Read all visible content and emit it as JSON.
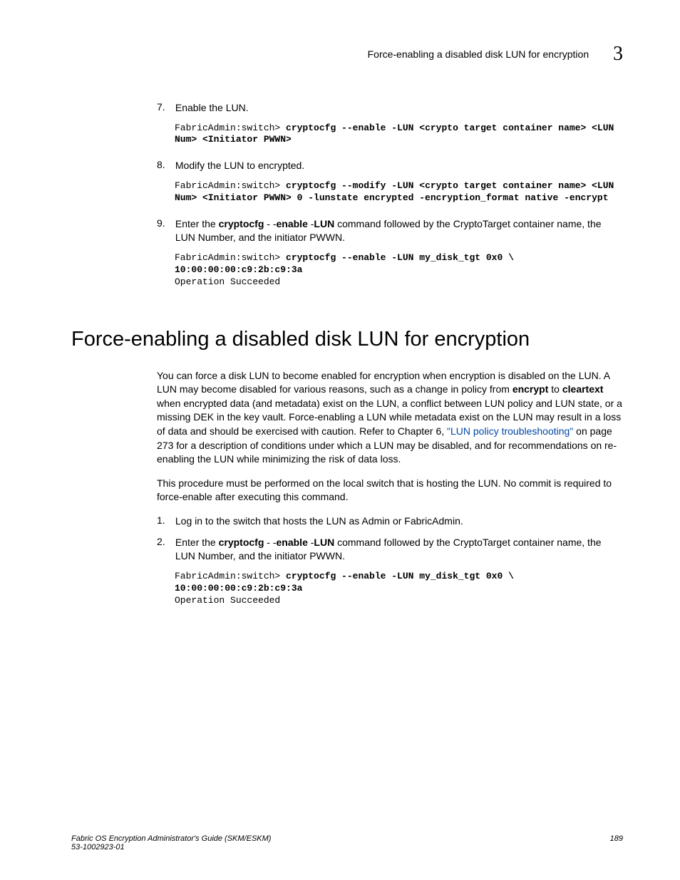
{
  "header": {
    "title": "Force-enabling a disabled disk LUN for encryption",
    "chapter": "3"
  },
  "steps": {
    "s7": {
      "num": "7.",
      "text": "Enable the LUN.",
      "code_prompt": "FabricAdmin:switch> ",
      "code_cmd": "cryptocfg --enable -LUN <crypto target container name> <LUN Num> <Initiator PWWN>"
    },
    "s8": {
      "num": "8.",
      "text": "Modify the LUN to encrypted.",
      "code_prompt": "FabricAdmin:switch> ",
      "code_cmd": "cryptocfg --modify -LUN <crypto target container name> <LUN Num> <Initiator PWWN> 0 -lunstate encrypted -encryption_format native -encrypt"
    },
    "s9": {
      "num": "9.",
      "text_pre": "Enter the ",
      "bold1": "cryptocfg",
      "text_mid1": " - -",
      "bold2": "enable",
      "text_mid2": "  -",
      "bold3": "LUN",
      "text_post": " command followed by the CryptoTarget container name, the LUN Number, and the initiator PWWN.",
      "code_prompt": "FabricAdmin:switch> ",
      "code_cmd": "cryptocfg --enable -LUN my_disk_tgt 0x0 \\\n10:00:00:00:c9:2b:c9:3a",
      "code_result": "Operation Succeeded"
    }
  },
  "section": {
    "heading": "Force-enabling a disabled disk LUN for encryption",
    "para1_a": "You can force a disk LUN to become enabled for encryption when encryption is disabled on the LUN. A LUN may become disabled for various reasons, such as a change in policy from ",
    "para1_b1": "encrypt",
    "para1_c": " to ",
    "para1_b2": "cleartext",
    "para1_d": " when encrypted data (and metadata) exist on the LUN, a conflict between LUN policy and LUN state, or a missing DEK in the key vault. Force-enabling a LUN while metadata exist on the LUN may result in a loss of data and should be exercised with caution. Refer to Chapter 6, ",
    "para1_link": "\"LUN policy troubleshooting\"",
    "para1_e": " on page 273 for a description of conditions under which a LUN may be disabled, and for recommendations on re-enabling the LUN while minimizing the risk of data loss.",
    "para2": "This procedure must be performed on the local switch that is hosting the LUN. No commit is required to force-enable after executing this command.",
    "step1": {
      "num": "1.",
      "text": "Log in to the switch that hosts the LUN as Admin or FabricAdmin."
    },
    "step2": {
      "num": "2.",
      "text_pre": "Enter the ",
      "bold1": "cryptocfg",
      "text_mid1": " - -",
      "bold2": "enable",
      "text_mid2": "  -",
      "bold3": "LUN",
      "text_post": " command followed by the CryptoTarget container name, the LUN Number, and the initiator PWWN.",
      "code_prompt": "FabricAdmin:switch> ",
      "code_cmd": "cryptocfg --enable -LUN my_disk_tgt 0x0 \\\n10:00:00:00:c9:2b:c9:3a",
      "code_result": "Operation Succeeded"
    }
  },
  "footer": {
    "left_line1": "Fabric OS Encryption Administrator's Guide (SKM/ESKM)",
    "left_line2": "53-1002923-01",
    "right": "189"
  }
}
